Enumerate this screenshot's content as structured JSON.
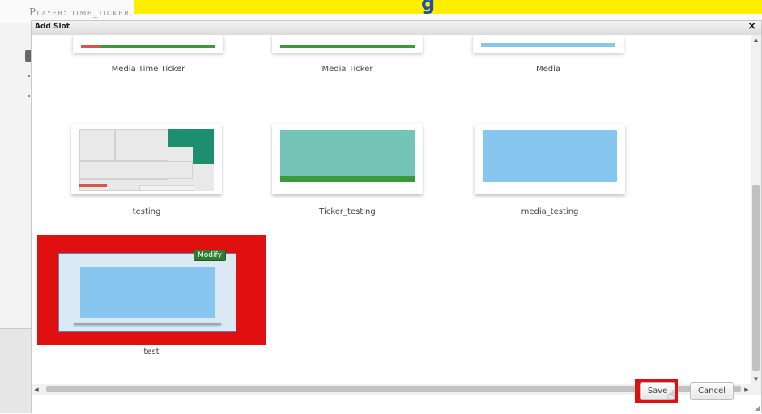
{
  "background": {
    "page_title": "Player: time_ticker",
    "banner_glyph": "g"
  },
  "dialog": {
    "title": "Add Slot",
    "close_label": "×",
    "slots": [
      {
        "label": "Media Time Ticker"
      },
      {
        "label": "Media Ticker"
      },
      {
        "label": "Media"
      },
      {
        "label": "testing"
      },
      {
        "label": "Ticker_testing"
      },
      {
        "label": "media_testing"
      },
      {
        "label": "test",
        "badge": "Modify",
        "selected": true
      }
    ],
    "buttons": {
      "save": "Save",
      "cancel": "Cancel"
    }
  },
  "colors": {
    "highlight": "#e01010",
    "teal": "#1e8f6e",
    "green": "#3a9a3a",
    "light_blue": "#87c6ee",
    "mint": "#74c5b8"
  }
}
